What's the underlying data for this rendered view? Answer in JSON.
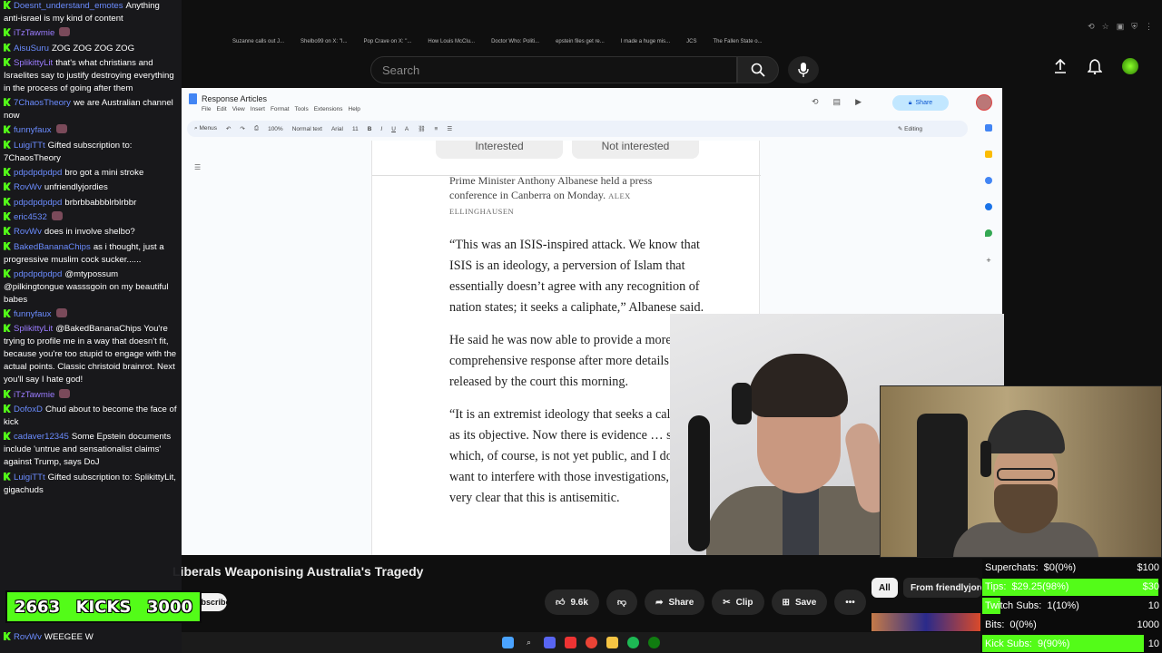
{
  "browser": {
    "bookmarks": [
      "Suzanne calls out J...",
      "Shelbo99 on X: \"I...",
      "Pop Crave on X: \"...",
      "How Louis McClu...",
      "Doctor Who: Politi...",
      "epstein files get re...",
      "I made a huge mis...",
      "JCS",
      "The Fallen State o..."
    ]
  },
  "youtube": {
    "search_placeholder": "Search",
    "video_title": "Liberals Weaponising Australia's Tragedy",
    "subscribe_label": "Subscribe",
    "likes": "9.6k",
    "share": "Share",
    "clip": "Clip",
    "save": "Save",
    "filter_all": "All",
    "filter_from": "From friendlyjordies"
  },
  "chat": {
    "messages": [
      {
        "user": "Doesnt_understand_emotes",
        "color": "blue",
        "text": "Anything anti-israel is my kind of content"
      },
      {
        "user": "iTzTawmie",
        "color": "purple",
        "text": ""
      },
      {
        "user": "AisuSuru",
        "color": "blue",
        "text": "ZOG ZOG ZOG ZOG"
      },
      {
        "user": "SplikittyLit",
        "color": "purple",
        "text": "that's what christians and Israelites say to justify destroying everything in the process of going after them"
      },
      {
        "user": "7ChaosTheory",
        "color": "blue",
        "text": "we are Australian channel now"
      },
      {
        "user": "funnyfaux",
        "color": "blue",
        "text": ""
      },
      {
        "user": "LuigiTTt",
        "color": "blue",
        "text": "Gifted subscription to: 7ChaosTheory"
      },
      {
        "user": "pdpdpdpdpd",
        "color": "blue",
        "text": "bro got a mini stroke"
      },
      {
        "user": "RovWv",
        "color": "blue",
        "text": "unfriendlyjordies"
      },
      {
        "user": "pdpdpdpdpd",
        "color": "blue",
        "text": "brbrbbabbblrblrbbr"
      },
      {
        "user": "eric4532",
        "color": "blue",
        "text": ""
      },
      {
        "user": "RovWv",
        "color": "blue",
        "text": "does in involve shelbo?"
      },
      {
        "user": "BakedBananaChips",
        "color": "blue",
        "text": "as i thought, just a progressive muslim cock sucker......"
      },
      {
        "user": "pdpdpdpdpd",
        "color": "blue",
        "text": "@mtypossum @pilkingtongue wasssgoin on my beautiful babes"
      },
      {
        "user": "funnyfaux",
        "color": "blue",
        "text": ""
      },
      {
        "user": "SplikittyLit",
        "color": "purple",
        "text": "@BakedBananaChips You're trying to profile me in a way that doesn't fit, because you're too stupid to engage with the actual points. Classic christoid brainrot. Next you'll say I hate god!"
      },
      {
        "user": "iTzTawmie",
        "color": "purple",
        "text": ""
      },
      {
        "user": "DofoxD",
        "color": "blue",
        "text": "Chud about to become the face of kick"
      },
      {
        "user": "cadaver12345",
        "color": "blue",
        "text": "Some Epstein documents include 'untrue and sensationalist claims' against Trump, says DoJ"
      },
      {
        "user": "LuigiTTt",
        "color": "blue",
        "text": "Gifted subscription to: SplikittyLit, gigachuds"
      }
    ],
    "bottom_user": "RovWv",
    "bottom_text": "WEEGEE W"
  },
  "kicks": {
    "current": "2663",
    "label": "KICKS",
    "goal": "3000"
  },
  "docs": {
    "title": "Response Articles",
    "menus": [
      "File",
      "Edit",
      "View",
      "Insert",
      "Format",
      "Tools",
      "Extensions",
      "Help"
    ],
    "share_label": "Share",
    "toolbar": {
      "menus": "Menus",
      "zoom": "100%",
      "style": "Normal text",
      "font": "Arial",
      "size": "11",
      "mode": "Editing"
    },
    "pill_left": "Interested",
    "pill_right": "Not interested",
    "caption": "Prime Minister Anthony Albanese held a press conference in Canberra on Monday.",
    "caption_credit": "ALEX ELLINGHAUSEN",
    "paragraphs": [
      "“This was an ISIS-inspired attack. We know that ISIS is an ideology, a perversion of Islam that essentially doesn’t agree with any recognition of nation states; it seeks a caliphate,” Albanese said.",
      "He said he was now able to provide a more comprehensive response after more details were released by the court this morning.",
      "“It is an extremist ideology that seeks a caliphate as its objective. Now there is evidence … some of which, of course, is not yet public, and I don’t want to interfere with those investigations, but it is very clear that this is antisemitic."
    ]
  },
  "goals": [
    {
      "label": "Superchats:",
      "value": "$0(0%)",
      "target": "$100",
      "fill": 0
    },
    {
      "label": "Tips:",
      "value": "$29.25(98%)",
      "target": "$30",
      "fill": 0.98
    },
    {
      "label": "Twitch Subs:",
      "value": "1(10%)",
      "target": "10",
      "fill": 0.1
    },
    {
      "label": "Bits:",
      "value": "0(0%)",
      "target": "1000",
      "fill": 0
    },
    {
      "label": "Kick Subs:",
      "value": "9(90%)",
      "target": "10",
      "fill": 0.9
    }
  ]
}
